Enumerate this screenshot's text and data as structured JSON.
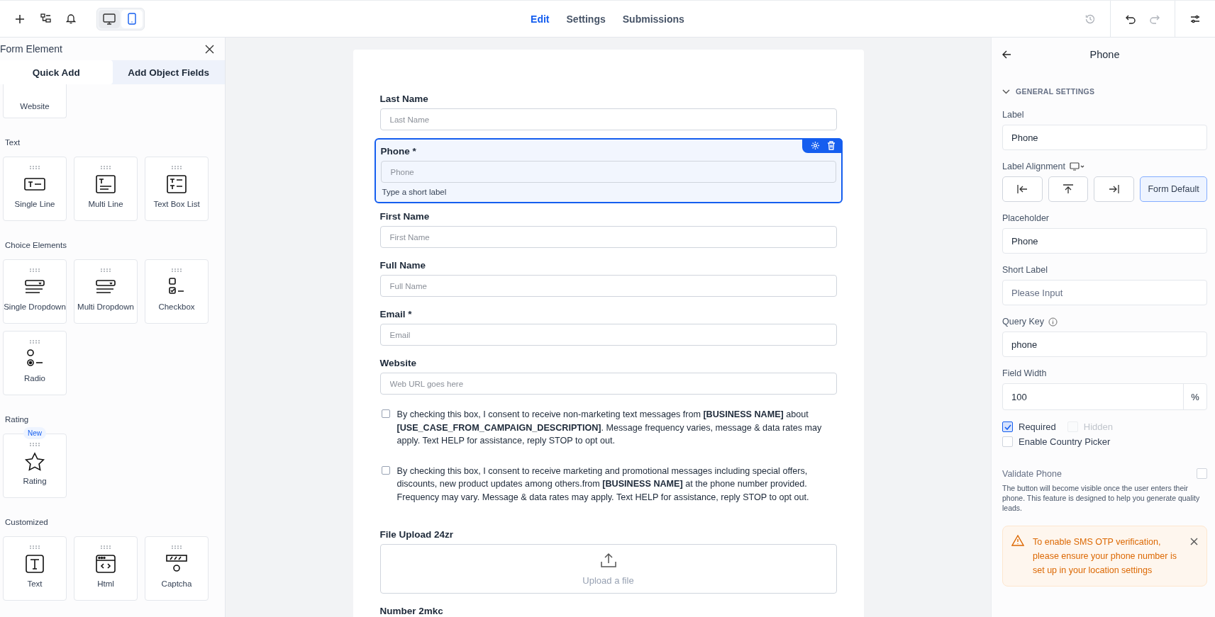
{
  "topbar": {
    "tools": [
      {
        "kind": "plus"
      },
      {
        "kind": "tree"
      },
      {
        "kind": "bell"
      }
    ],
    "devices": [
      {
        "kind": "desktop",
        "selected": false
      },
      {
        "kind": "mobile",
        "selected": true
      }
    ],
    "tabs": [
      {
        "label": "Edit",
        "selected": true
      },
      {
        "label": "Settings",
        "selected": false
      },
      {
        "label": "Submissions",
        "selected": false
      }
    ],
    "actions": [
      {
        "kind": "history",
        "disabled": true
      },
      {
        "kind": "undo",
        "disabled": false
      },
      {
        "kind": "redo",
        "disabled": true
      },
      {
        "kind": "sliders",
        "disabled": false
      }
    ]
  },
  "left_panel": {
    "title": "Form Element",
    "tabs": [
      {
        "label": "Quick Add",
        "selected": false
      },
      {
        "label": "Add Object Fields",
        "selected": true
      }
    ],
    "cut_tile": {
      "label": "Website"
    },
    "sections": [
      {
        "title": "Text",
        "tiles": [
          {
            "label": "Single Line",
            "kind": "single-line"
          },
          {
            "label": "Multi Line",
            "kind": "multi-line"
          },
          {
            "label": "Text Box List",
            "kind": "text-list"
          }
        ]
      },
      {
        "title": "Choice Elements",
        "tiles": [
          {
            "label": "Single Dropdown",
            "kind": "dropdown"
          },
          {
            "label": "Multi Dropdown",
            "kind": "dropdown"
          },
          {
            "label": "Checkbox",
            "kind": "checkbox"
          },
          {
            "label": "Radio",
            "kind": "radio"
          }
        ]
      },
      {
        "title": "Rating",
        "tiles": [
          {
            "label": "Rating",
            "kind": "star",
            "badge": "New"
          }
        ]
      },
      {
        "title": "Customized",
        "tiles": [
          {
            "label": "Text",
            "kind": "text"
          },
          {
            "label": "Html",
            "kind": "html"
          },
          {
            "label": "Captcha",
            "kind": "captcha"
          }
        ]
      }
    ]
  },
  "form": {
    "fields": [
      {
        "kind": "input",
        "label": "Last Name",
        "placeholder": "Last Name",
        "selected": false
      },
      {
        "kind": "input",
        "label": "Phone *",
        "placeholder": "Phone",
        "selected": true,
        "hint": "Type a short label"
      },
      {
        "kind": "input",
        "label": "First Name",
        "placeholder": "First Name",
        "selected": false
      },
      {
        "kind": "input",
        "label": "Full Name",
        "placeholder": "Full Name",
        "selected": false
      },
      {
        "kind": "input",
        "label": "Email *",
        "placeholder": "Email",
        "selected": false
      },
      {
        "kind": "input",
        "label": "Website",
        "placeholder": "Web URL goes here",
        "selected": false
      },
      {
        "kind": "consent",
        "selected": false,
        "checked": false,
        "text": "By checking this box, I consent to receive non-marketing text messages from **[BUSINESS NAME]** about **[USE_CASE_FROM_CAMPAIGN_DESCRIPTION]**. Message frequency varies, message & data rates may apply. Text HELP for assistance, reply STOP to opt out."
      },
      {
        "kind": "consent",
        "selected": false,
        "checked": false,
        "text": "By checking this box, I consent to receive marketing and promotional messages including special offers, discounts, new product updates among others.from **[BUSINESS NAME]** at the phone number provided. Frequency may vary. Message & data rates may apply. Text HELP for assistance, reply STOP to opt out."
      },
      {
        "kind": "upload",
        "label": "File Upload 24zr",
        "button": "Upload a file",
        "selected": false
      },
      {
        "kind": "heading",
        "label": "Number 2mkc",
        "selected": false
      }
    ]
  },
  "right_panel": {
    "title": "Phone",
    "section": "GENERAL SETTINGS",
    "expanded": true,
    "label": {
      "caption": "Label",
      "value": "Phone"
    },
    "alignment": {
      "caption": "Label Alignment",
      "options": [
        {
          "kind": "left",
          "selected": false
        },
        {
          "kind": "top",
          "selected": false
        },
        {
          "kind": "right",
          "selected": false
        },
        {
          "kind": "text",
          "label": "Form Default",
          "selected": true
        }
      ]
    },
    "placeholder": {
      "caption": "Placeholder",
      "value": "Phone"
    },
    "short_label": {
      "caption": "Short Label",
      "placeholder": "Please Input"
    },
    "query_key": {
      "caption": "Query Key",
      "value": "phone"
    },
    "field_width": {
      "caption": "Field Width",
      "value": "100",
      "unit": "%"
    },
    "checks": [
      {
        "label": "Required",
        "checked": true,
        "disabled": false
      },
      {
        "label": "Hidden",
        "checked": false,
        "disabled": true
      },
      {
        "label": "Enable Country Picker",
        "checked": false,
        "disabled": false
      }
    ],
    "validate": {
      "caption": "Validate Phone",
      "checked": false,
      "description": "The button will become visible once the user enters their phone. This feature is designed to help you generate quality leads."
    },
    "alert": {
      "text": "To enable SMS OTP verification, please ensure your phone number is set up in your location settings"
    }
  }
}
